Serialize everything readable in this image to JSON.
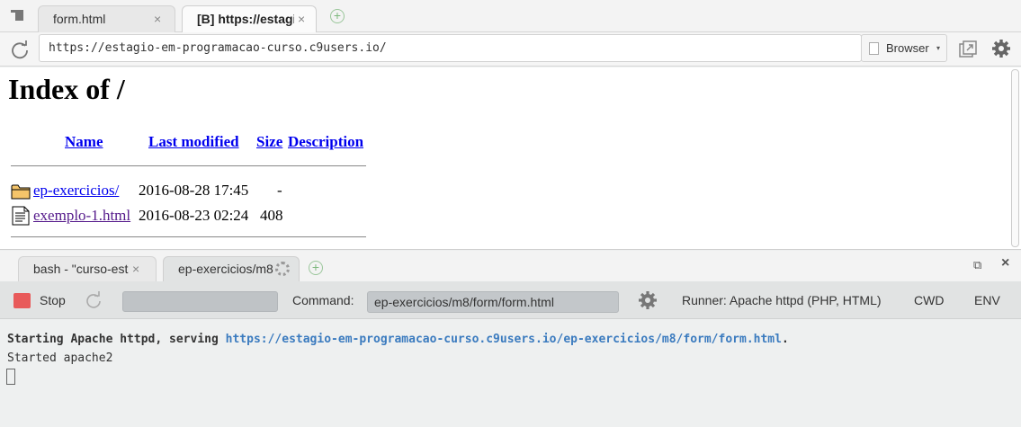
{
  "editor_tabs": [
    {
      "label": "form.html",
      "close": "×"
    },
    {
      "label": "[B] https://estagio",
      "close": "×"
    }
  ],
  "toolbar": {
    "url": "https://estagio-em-programacao-curso.c9users.io/",
    "browser_label": "Browser",
    "browser_caret": "▾"
  },
  "page": {
    "title": "Index of /",
    "columns": [
      "Name",
      "Last modified",
      "Size",
      "Description"
    ],
    "rows": [
      {
        "name": "ep-exercicios/",
        "modified": "2016-08-28 17:45",
        "size": "-",
        "icon": "folder-icon"
      },
      {
        "name": "exemplo-1.html",
        "modified": "2016-08-23 02:24",
        "size": "408",
        "icon": "file-icon"
      }
    ]
  },
  "bottom_tabs": [
    {
      "label": "bash - \"curso-est",
      "close": "×"
    },
    {
      "label": "ep-exercicios/m8"
    }
  ],
  "window_buttons": {
    "restore": "⧉",
    "close": "×"
  },
  "runner": {
    "stop_label": "Stop",
    "command_label": "Command:",
    "command_value": "ep-exercicios/m8/form/form.html",
    "runner_label": "Runner: Apache httpd (PHP, HTML)",
    "cwd_label": "CWD",
    "env_label": "ENV"
  },
  "terminal": {
    "line1_prefix": "Starting Apache httpd, serving ",
    "line1_link": "https://estagio-em-programacao-curso.c9users.io/ep-exercicios/m8/form/form.html",
    "line1_suffix": ".",
    "line2": "Started apache2"
  },
  "colors": {
    "stop": "#e85a5a",
    "link": "#0000ee",
    "visited": "#551a8b",
    "term_link": "#3b7bbf"
  }
}
